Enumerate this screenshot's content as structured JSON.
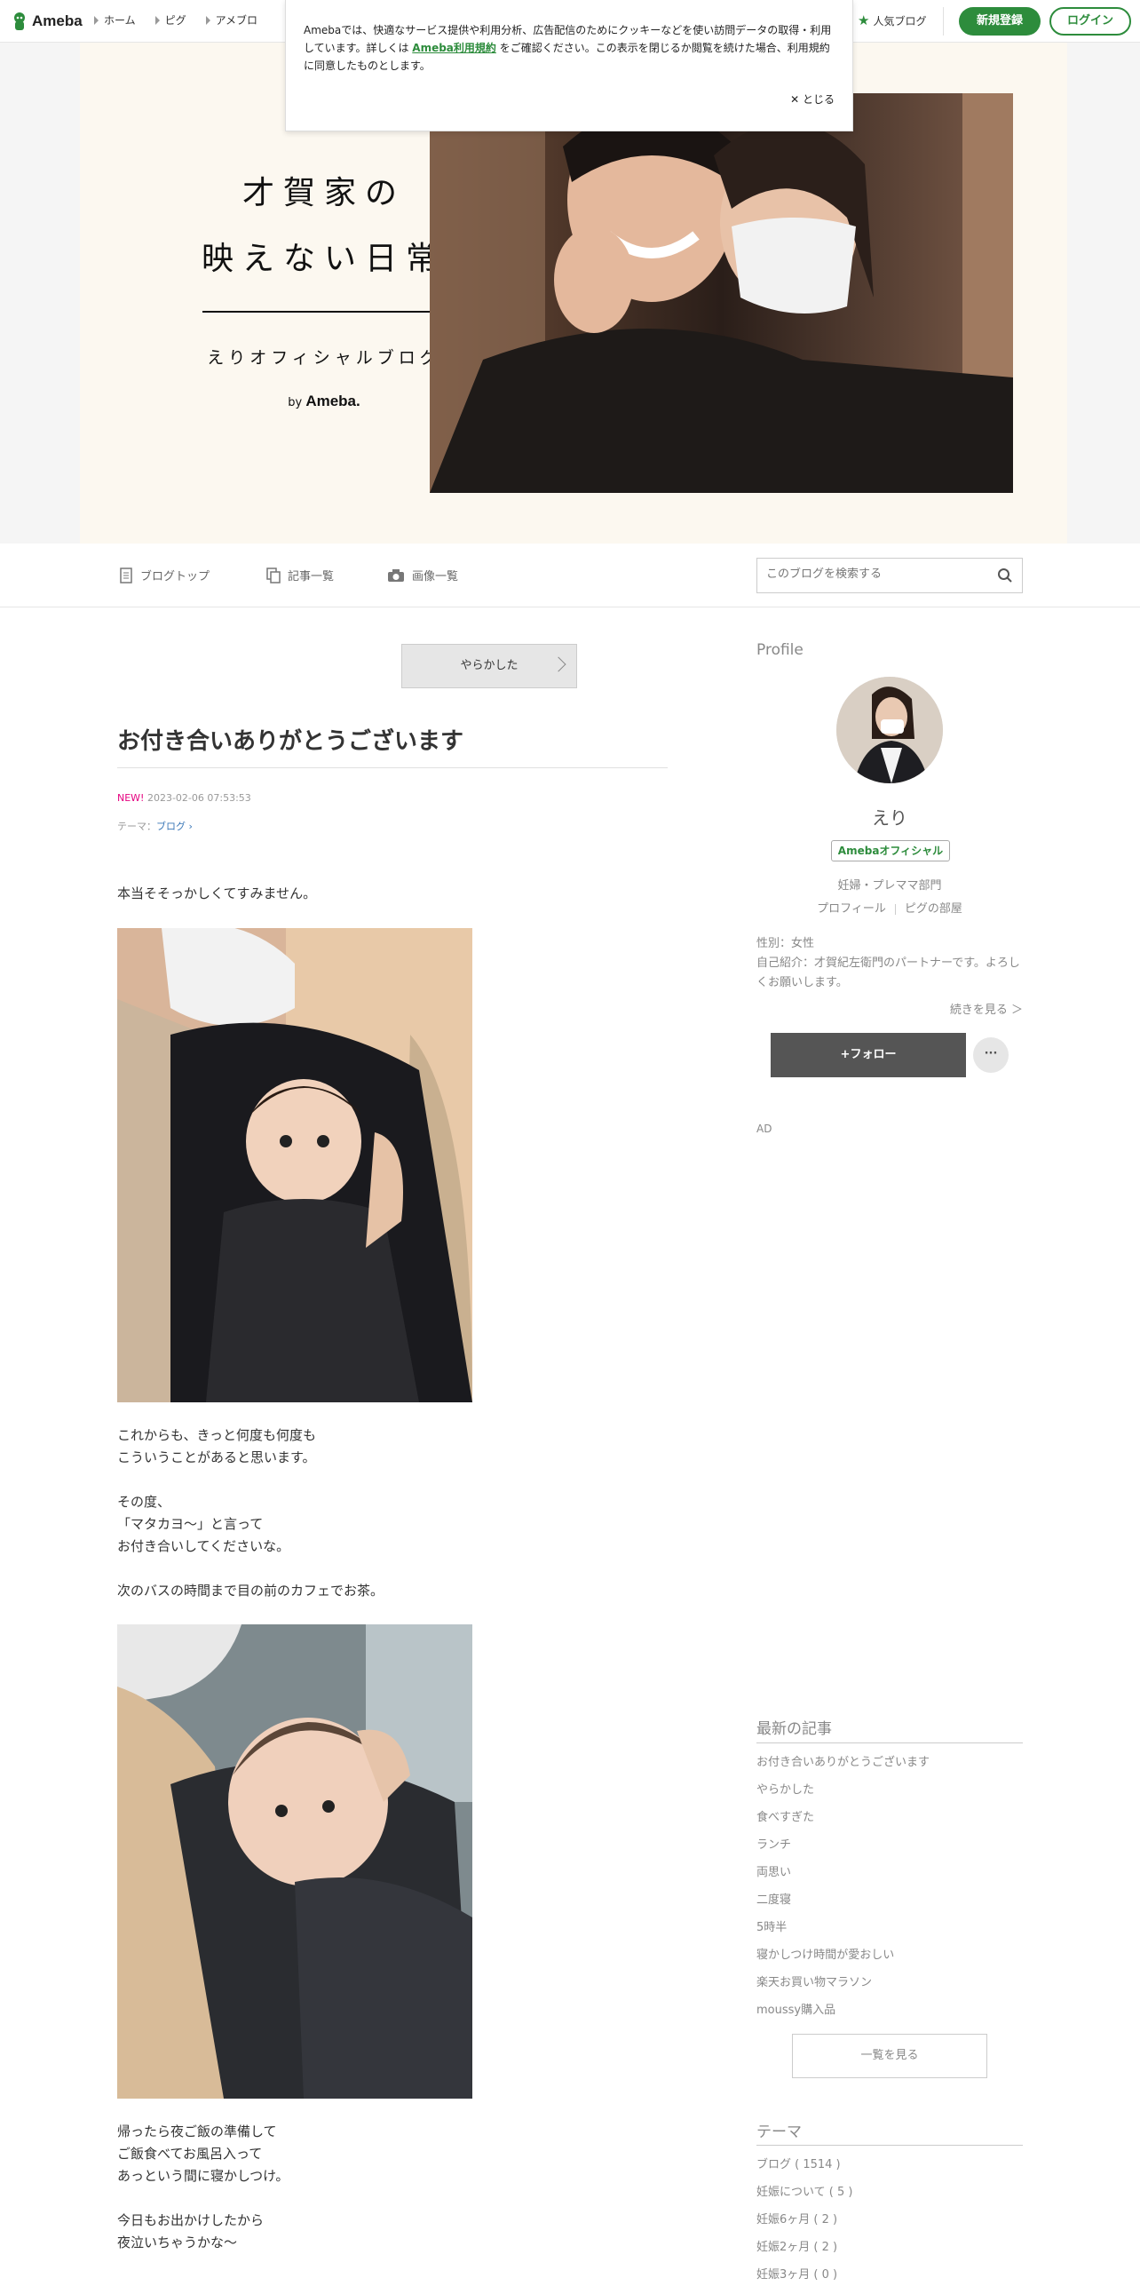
{
  "topbar": {
    "logo": "Ameba",
    "nav": [
      "ホーム",
      "ピグ",
      "アメブロ"
    ],
    "popular": "人気ブログ",
    "register": "新規登録",
    "login": "ログイン"
  },
  "cookie": {
    "text_before": "Amebaでは、快適なサービス提供や利用分析、広告配信のためにクッキーなどを使い訪問データの取得・利用しています。詳しくは",
    "link": "Ameba利用規約",
    "text_after": "をご確認ください。この表示を閉じるか閲覧を続けた場合、利用規約に同意したものとします。",
    "close": "とじる"
  },
  "header": {
    "title_line1": "才賀家の",
    "title_line2": "映えない日常",
    "subtitle": "えりオフィシャルブログ",
    "by": "by",
    "brand": "Ameba."
  },
  "blognav": {
    "top": "ブログトップ",
    "list": "記事一覧",
    "images": "画像一覧",
    "search_placeholder": "このブログを検索する"
  },
  "article": {
    "prev": "やらかした",
    "title": "お付き合いありがとうございます",
    "new": "NEW!",
    "date": "2023-02-06 07:53:53",
    "theme_label": "テーマ：",
    "theme": "ブログ",
    "p1": "本当そそっかしくてすみません。",
    "p2_l1": "これからも、きっと何度も何度も",
    "p2_l2": "こういうことがあると思います。",
    "p3_l1": "その度、",
    "p3_l2": "「マタカヨ〜」と言って",
    "p3_l3": "お付き合いしてくださいな。",
    "p4": "次のバスの時間まで目の前のカフェでお茶。",
    "p5_l1": "帰ったら夜ご飯の準備して",
    "p5_l2": "ご飯食べてお風呂入って",
    "p5_l3": "あっという間に寝かしつけ。",
    "p6_l1": "今日もお出かけしたから",
    "p6_l2": "夜泣いちゃうかな〜"
  },
  "profile": {
    "heading": "Profile",
    "name": "えり",
    "badge": "Amebaオフィシャル",
    "category": "妊婦・プレママ部門",
    "link1": "プロフィール",
    "link2": "ピグの部屋",
    "gender": "性別：女性",
    "intro": "自己紹介：才賀紀左衛門のパートナーです。よろしくお願いします。",
    "more": "続きを見る ＞",
    "follow": "+フォロー",
    "dots": "···",
    "ad": "AD"
  },
  "recent": {
    "heading": "最新の記事",
    "items": [
      "お付き合いありがとうございます",
      "やらかした",
      "食べすぎた",
      "ランチ",
      "両思い",
      "二度寝",
      "5時半",
      "寝かしつけ時間が愛おしい",
      "楽天お買い物マラソン",
      "moussy購入品"
    ],
    "more": "一覧を見る"
  },
  "themes": {
    "heading": "テーマ",
    "items": [
      "ブログ ( 1514 )",
      "妊娠について ( 5 )",
      "妊娠6ヶ月 ( 2 )",
      "妊娠2ヶ月 ( 2 )",
      "妊娠3ヶ月 ( 0 )"
    ]
  },
  "colors": {
    "accent": "#2d8c3c",
    "new": "#e5007f",
    "link": "#3a77b7"
  }
}
